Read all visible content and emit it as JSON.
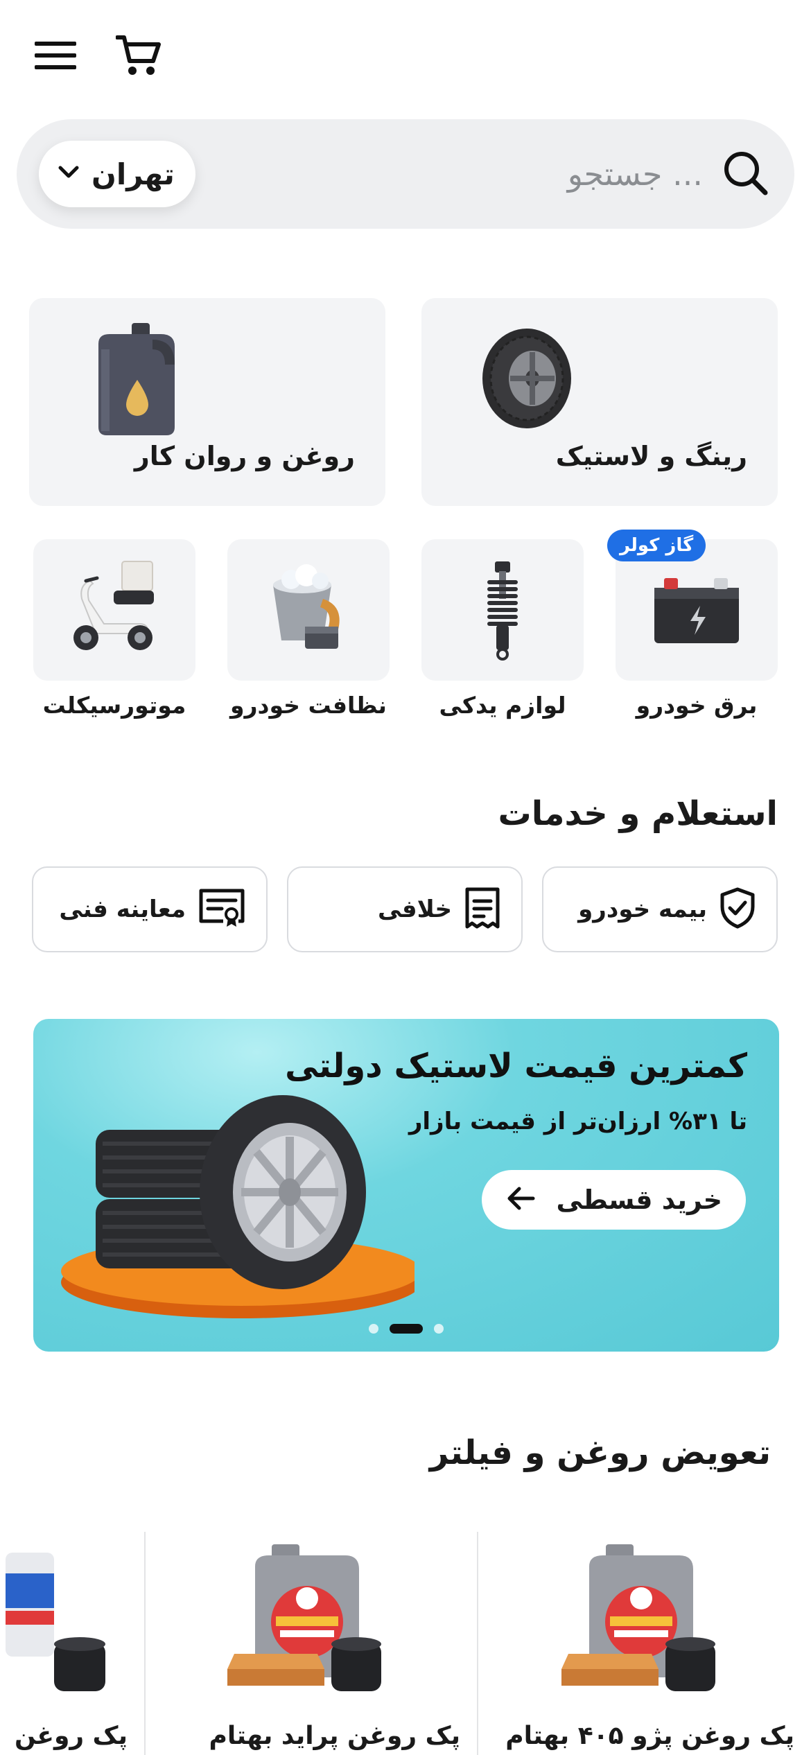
{
  "search": {
    "placeholder": "جستجو ...",
    "city": "تهران"
  },
  "categories_big": [
    {
      "label": "رینگ و لاستیک",
      "icon": "tire-icon"
    },
    {
      "label": "روغن و روان کار",
      "icon": "oil-can-icon"
    }
  ],
  "categories_small": [
    {
      "label": "برق خودرو",
      "icon": "battery-icon",
      "badge": "گاز کولر"
    },
    {
      "label": "لوازم یدکی",
      "icon": "shock-absorber-icon"
    },
    {
      "label": "نظافت خودرو",
      "icon": "cleaning-bucket-icon"
    },
    {
      "label": "موتورسیکلت",
      "icon": "scooter-icon"
    }
  ],
  "services": {
    "title": "استعلام و خدمات",
    "items": [
      {
        "label": "بیمه خودرو",
        "icon": "shield-check-icon"
      },
      {
        "label": "خلافی",
        "icon": "receipt-icon"
      },
      {
        "label": "معاینه فنی",
        "icon": "certificate-icon"
      }
    ]
  },
  "banner": {
    "title": "کمترین قیمت لاستیک دولتی",
    "subtitle": "تا ۳۱% ارزان‌تر از قیمت بازار",
    "button": "خرید قسطی",
    "slide_count": 3,
    "active_slide": 2
  },
  "oil_section": {
    "title": "تعویض روغن و فیلتر",
    "products": [
      {
        "name": "پک روغن پژو ۴۰۵ بهتام"
      },
      {
        "name": "پک روغن پراید بهتام"
      },
      {
        "name": "پک روغن"
      }
    ]
  },
  "colors": {
    "accent": "#1f6fe5",
    "card": "#f3f4f6",
    "banner": "#5fcfdb"
  }
}
